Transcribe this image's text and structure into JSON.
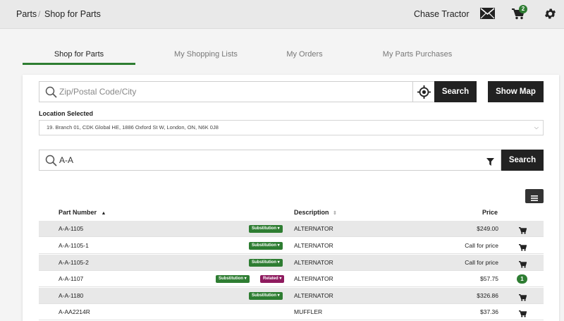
{
  "breadcrumb": {
    "root": "Parts",
    "separator": "/",
    "current": "Shop for Parts"
  },
  "header": {
    "user_name": "Chase Tractor",
    "cart_count": "2"
  },
  "tabs": [
    {
      "label": "Shop for Parts",
      "active": true
    },
    {
      "label": "My Shopping Lists",
      "active": false
    },
    {
      "label": "My Orders",
      "active": false
    },
    {
      "label": "My Parts Purchases",
      "active": false
    }
  ],
  "location_search": {
    "placeholder": "Zip/Postal Code/City",
    "value": "",
    "search_label": "Search",
    "map_label": "Show Map"
  },
  "location": {
    "label": "Location Selected",
    "selected": "19. Branch 01, CDK Global HE, 1886 Oxford St W, London, ON, N6K 0J8"
  },
  "part_search": {
    "value": "A-A",
    "search_label": "Search"
  },
  "table": {
    "headers": {
      "part_number": "Part Number",
      "description": "Description",
      "price": "Price"
    },
    "rows": [
      {
        "part_number": "A-A-1105",
        "substitution": "Substitution",
        "related": "",
        "description": "ALTERNATOR",
        "price": "$249.00",
        "qty": ""
      },
      {
        "part_number": "A-A-1105-1",
        "substitution": "Substitution",
        "related": "",
        "description": "ALTERNATOR",
        "price": "Call for price",
        "qty": ""
      },
      {
        "part_number": "A-A-1105-2",
        "substitution": "Substitution",
        "related": "",
        "description": "ALTERNATOR",
        "price": "Call for price",
        "qty": ""
      },
      {
        "part_number": "A-A-1107",
        "substitution": "Substitution",
        "related": "Related",
        "description": "ALTERNATOR",
        "price": "$57.75",
        "qty": "1"
      },
      {
        "part_number": "A-A-1180",
        "substitution": "Substitution",
        "related": "",
        "description": "ALTERNATOR",
        "price": "$326.86",
        "qty": ""
      },
      {
        "part_number": "A-AA2214R",
        "substitution": "",
        "related": "",
        "description": "MUFFLER",
        "price": "$37.36",
        "qty": ""
      }
    ]
  },
  "colors": {
    "accent_green": "#2e7d32",
    "related_magenta": "#8e1a5e",
    "dark_button": "#222222"
  }
}
